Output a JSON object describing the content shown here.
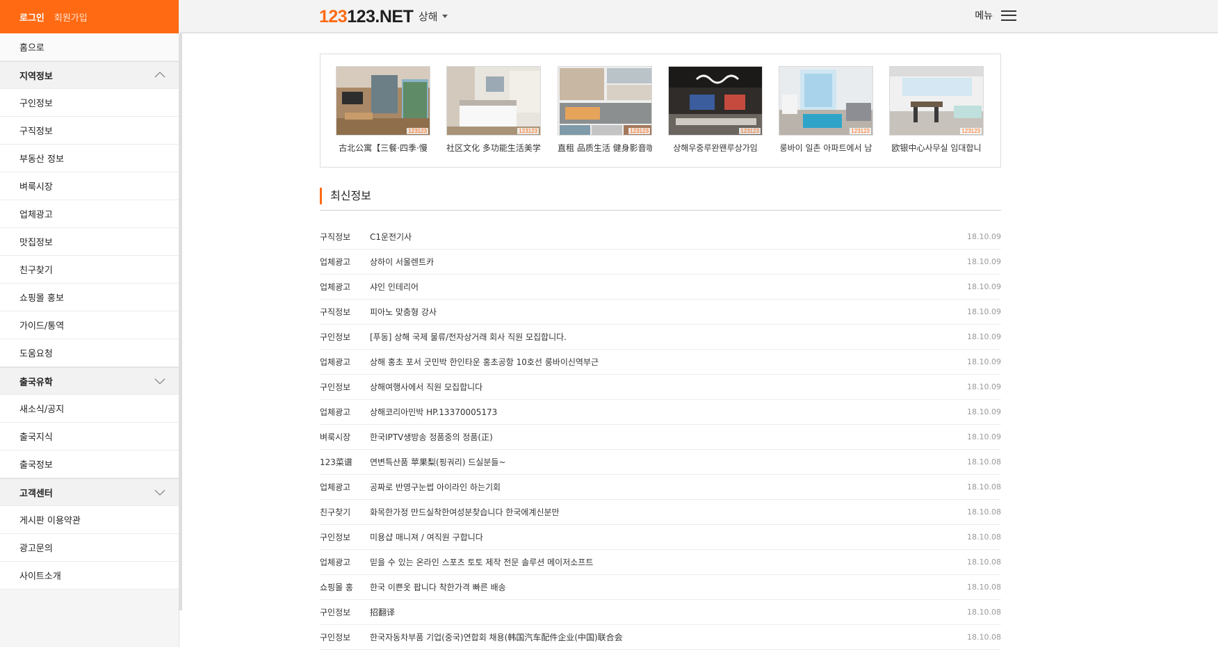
{
  "sidebar": {
    "login": "로그인",
    "join": "회원가입",
    "home": "홈으로",
    "section1": "지역정보",
    "items1": [
      "구인정보",
      "구직정보",
      "부동산 정보",
      "벼룩시장",
      "업체광고",
      "맛집정보",
      "친구찾기",
      "쇼핑몰 홍보",
      "가이드/통역",
      "도움요청"
    ],
    "section2": "출국유학",
    "items2": [
      "새소식/공지",
      "출국지식",
      "출국정보"
    ],
    "section3": "고객센터",
    "items3": [
      "게시판 이용약관",
      "광고문의",
      "사이트소개"
    ]
  },
  "header": {
    "logo_accent": "123",
    "logo_rest": "123.NET",
    "region": "상해",
    "menu_label": "메뉴"
  },
  "gallery": [
    {
      "caption": "古北公寓【三餐·四季·慢",
      "watermark": "123123"
    },
    {
      "caption": "社区文化 多功能生活美学",
      "watermark": "123123"
    },
    {
      "caption": "直租 品质生活 健身影音咖",
      "watermark": "123123"
    },
    {
      "caption": "상해우중루완왠루상가임",
      "watermark": "123123"
    },
    {
      "caption": "룽바이 일촌 아파트에서 남",
      "watermark": "123123"
    },
    {
      "caption": "欧银中心사무실 임대합니",
      "watermark": "123123"
    }
  ],
  "latest": {
    "title": "최신정보",
    "rows": [
      {
        "cat": "구직정보",
        "title": "C1운전기사",
        "date": "18.10.09"
      },
      {
        "cat": "업체광고",
        "title": "상하이 서울렌트카",
        "date": "18.10.09"
      },
      {
        "cat": "업체광고",
        "title": "샤인 인테리어",
        "date": "18.10.09"
      },
      {
        "cat": "구직정보",
        "title": "피아노 맞춤형 강사",
        "date": "18.10.09"
      },
      {
        "cat": "구인정보",
        "title": "[푸동] 상해 국제 물류/전자상거래 회사 직원 모집합니다.",
        "date": "18.10.09"
      },
      {
        "cat": "업체광고",
        "title": "상해 홍초 포서 굿민박 한인타운 홍초공항 10호선 룽바이신역부근",
        "date": "18.10.09"
      },
      {
        "cat": "구인정보",
        "title": "상해여행사에서 직원 모집합니다",
        "date": "18.10.09"
      },
      {
        "cat": "업체광고",
        "title": "상해코리아민박 HP.13370005173",
        "date": "18.10.09"
      },
      {
        "cat": "벼룩시장",
        "title": "한국IPTV생방송 정품중의 정품(正)",
        "date": "18.10.09"
      },
      {
        "cat": "123菜谱",
        "title": "연변특산품 苹果梨(핑궈리) 드실분들~",
        "date": "18.10.08"
      },
      {
        "cat": "업체광고",
        "title": "공짜로 반영구눈썹 아이라인 하는기회",
        "date": "18.10.08"
      },
      {
        "cat": "친구찾기",
        "title": "화목한가정 만드실착한여성분찾습니다 한국에계신분만",
        "date": "18.10.08"
      },
      {
        "cat": "구인정보",
        "title": "미용샵 매니져 / 여직원 구합니다",
        "date": "18.10.08"
      },
      {
        "cat": "업체광고",
        "title": "믿을 수 있는 온라인 스포츠 토토 제작 전문 솔루션 메이저소프트",
        "date": "18.10.08"
      },
      {
        "cat": "쇼핑몰 홍",
        "title": "한국 이쁜옷 팝니다 착한가격 빠른 배송",
        "date": "18.10.08"
      },
      {
        "cat": "구인정보",
        "title": "招翻译",
        "date": "18.10.08"
      },
      {
        "cat": "구인정보",
        "title": "한국자동차부품 기업(중국)연합회 채용(韩国汽车配件企业(中国)联合会",
        "date": "18.10.08"
      }
    ]
  },
  "colors": {
    "brand": "#ff6a13"
  }
}
